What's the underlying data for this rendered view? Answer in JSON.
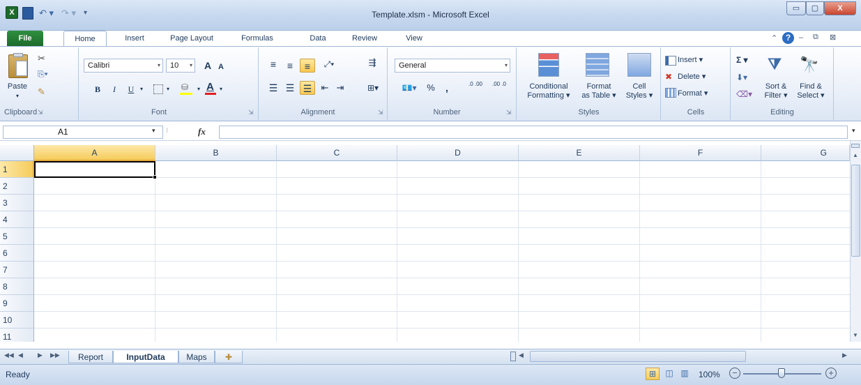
{
  "window": {
    "title": "Template.xlsm - Microsoft Excel",
    "min": "▭",
    "max": "▢",
    "close": "X"
  },
  "tabs": [
    "File",
    "Home",
    "Insert",
    "Page Layout",
    "Formulas",
    "Data",
    "Review",
    "View"
  ],
  "clipboard": {
    "paste": "Paste",
    "group": "Clipboard"
  },
  "font": {
    "name": "Calibri",
    "size": "10",
    "bold": "B",
    "italic": "I",
    "underline": "U",
    "grow": "A",
    "shrink": "A",
    "fontcolor": "A",
    "group": "Font"
  },
  "alignment": {
    "group": "Alignment"
  },
  "number": {
    "format": "General",
    "percent": "%",
    "comma": ",",
    "inc": ".0 .00",
    "dec": ".00 .0",
    "group": "Number"
  },
  "styles": {
    "conditional": "Conditional",
    "conditional2": "Formatting ▾",
    "table": "Format",
    "table2": "as Table ▾",
    "cell": "Cell",
    "cell2": "Styles ▾",
    "group": "Styles"
  },
  "cells": {
    "insert": "Insert ▾",
    "delete": "Delete ▾",
    "format": "Format ▾",
    "group": "Cells"
  },
  "editing": {
    "sum": "Σ ▾",
    "sort": "Sort &",
    "sort2": "Filter ▾",
    "find": "Find &",
    "find2": "Select ▾",
    "group": "Editing"
  },
  "formula_bar": {
    "cell_ref": "A1",
    "fx": "fx",
    "value": ""
  },
  "grid": {
    "columns": [
      "A",
      "B",
      "C",
      "D",
      "E",
      "F",
      "G"
    ],
    "rows": [
      "1",
      "2",
      "3",
      "4",
      "5",
      "6",
      "7",
      "8",
      "9",
      "10",
      "11"
    ]
  },
  "sheets": {
    "tabs": [
      "Report",
      "InputData",
      "Maps"
    ],
    "active": "InputData"
  },
  "status": {
    "ready": "Ready",
    "zoom": "100%"
  },
  "colors": {
    "accent": "#1e395b",
    "file_tab": "#1d6b2c",
    "selected": "#f8c850"
  }
}
